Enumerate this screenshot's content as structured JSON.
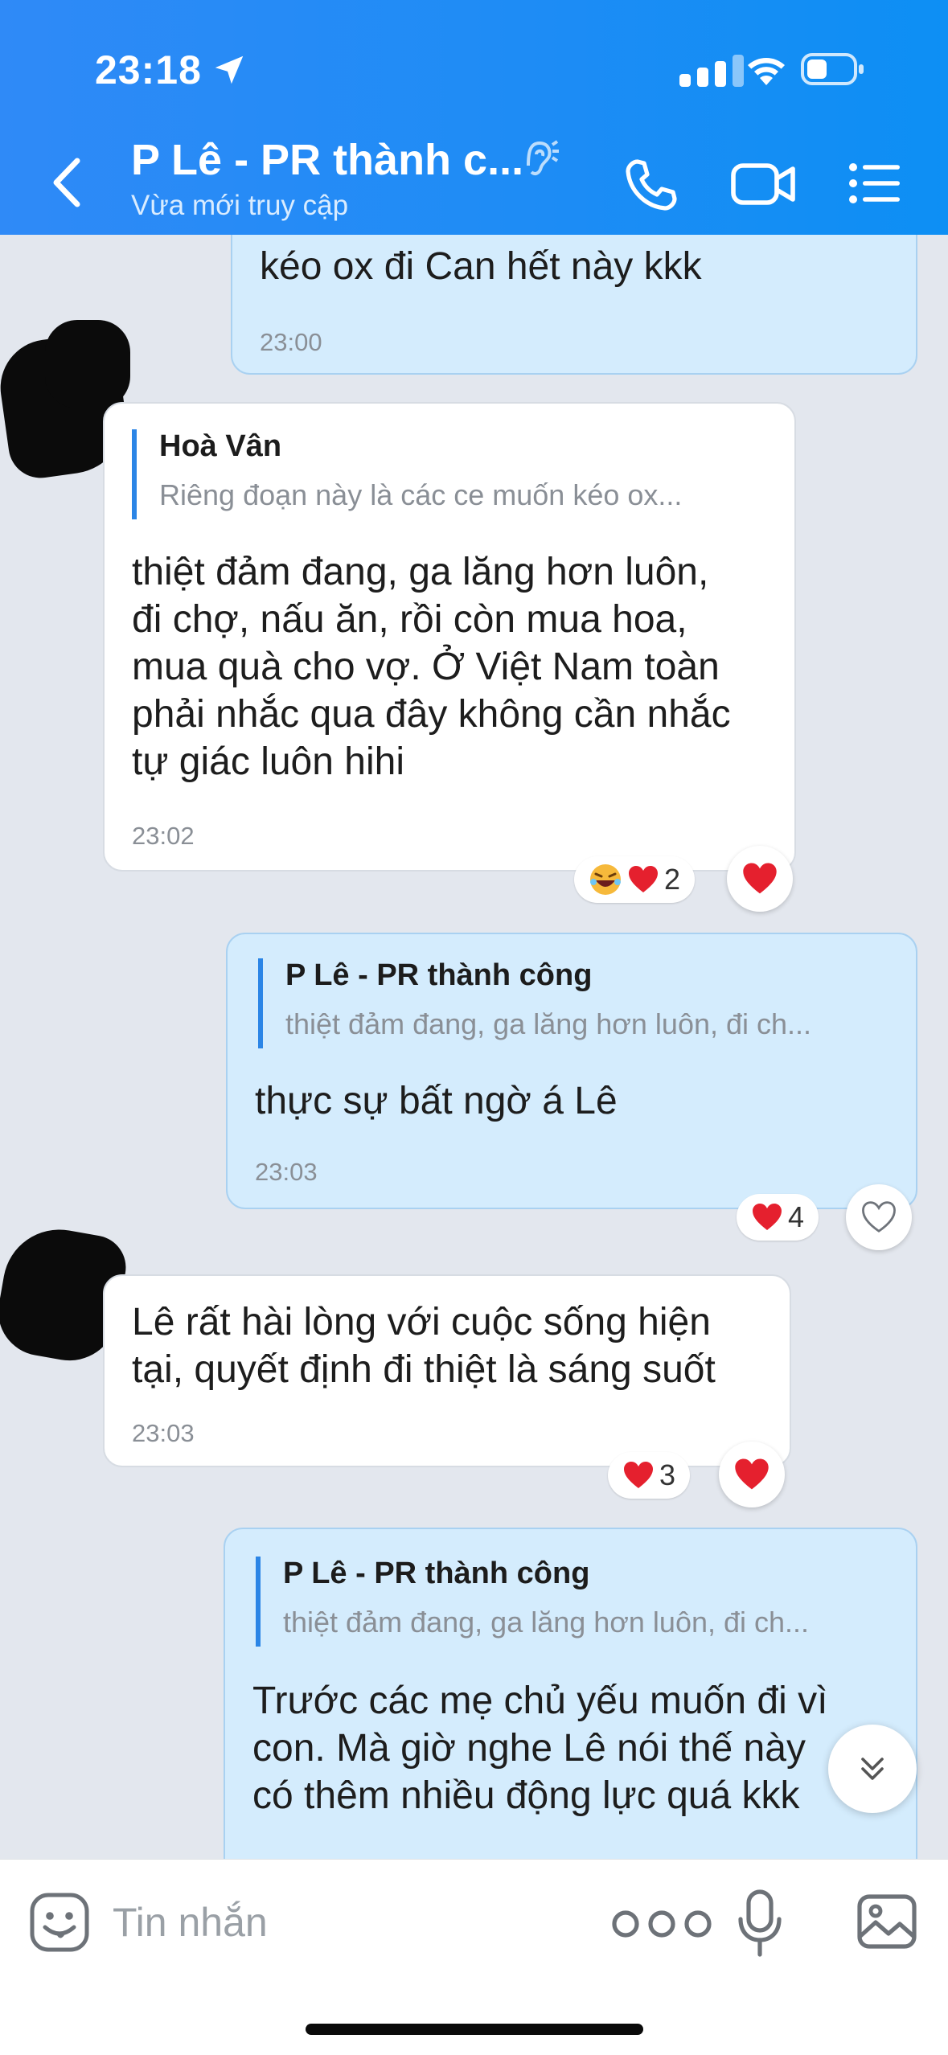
{
  "status_bar": {
    "time": "23:18"
  },
  "header": {
    "title": "P Lê - PR thành c...",
    "subtitle": "Vừa mới truy cập",
    "icons": [
      "back-icon",
      "ear-icon",
      "phone-icon",
      "video-camera-icon",
      "list-menu-icon"
    ]
  },
  "messages": [
    {
      "direction": "out",
      "text": "kéo ox đi Can hết này kkk",
      "time": "23:00"
    },
    {
      "direction": "in",
      "quote": {
        "name": "Hoà Vân",
        "text": "Riêng đoạn này là các ce muốn kéo ox..."
      },
      "lines": [
        "thiệt đảm đang, ga lăng hơn luôn,",
        "đi chợ, nấu ăn, rồi còn mua hoa,",
        "mua quà cho vợ. Ở Việt Nam toàn",
        "phải nhắc qua đây không cần nhắc",
        "tự giác luôn hihi"
      ],
      "time": "23:02",
      "reactions": {
        "count": "2",
        "icons": [
          "laughing-face",
          "red-heart"
        ]
      }
    },
    {
      "direction": "out",
      "quote": {
        "name": "P Lê - PR thành công",
        "text": "thiệt đảm đang, ga lăng hơn luôn, đi ch..."
      },
      "text": "thực sự bất ngờ á Lê",
      "time": "23:03",
      "reactions": {
        "count": "4",
        "icons": [
          "red-heart"
        ]
      }
    },
    {
      "direction": "in",
      "lines": [
        "Lê rất hài lòng với cuộc sống hiện",
        "tại, quyết định đi thiệt là sáng suốt"
      ],
      "time": "23:03",
      "reactions": {
        "count": "3",
        "icons": [
          "red-heart"
        ]
      }
    },
    {
      "direction": "out",
      "quote": {
        "name": "P Lê - PR thành công",
        "text": "thiệt đảm đang, ga lăng hơn luôn, đi ch..."
      },
      "lines": [
        "Trước các mẹ chủ yếu muốn đi vì",
        "con. Mà giờ nghe Lê nói thế này",
        "có thêm nhiều động lực quá kkk"
      ]
    }
  ],
  "input": {
    "placeholder": "Tin nhắn"
  },
  "colors": {
    "header": "#1e8cf5",
    "bubble_out": "#d4ecfd",
    "bubble_in": "#ffffff",
    "background": "#e3e7ee",
    "heart": "#e5202e"
  }
}
